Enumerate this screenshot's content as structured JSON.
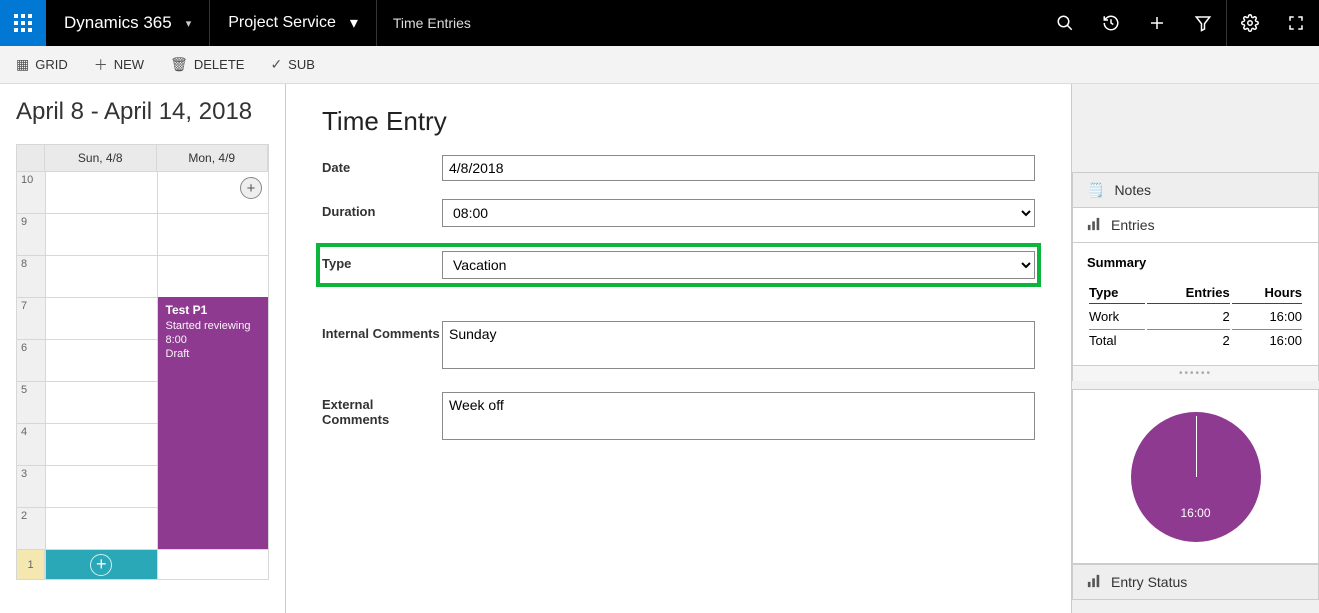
{
  "topbar": {
    "brand": "Dynamics 365",
    "module": "Project Service",
    "breadcrumb": "Time Entries"
  },
  "cmdbar": {
    "grid": "GRID",
    "new": "NEW",
    "delete": "DELETE",
    "submit": "SUBMIT"
  },
  "calendar": {
    "title": "April 8 - April 14, 2018",
    "cols": [
      "Sun, 4/8",
      "Mon, 4/9"
    ],
    "hours": [
      "10",
      "9",
      "8",
      "7",
      "6",
      "5",
      "4",
      "3",
      "2"
    ],
    "allday_label": "1",
    "event": {
      "title": "Test P1",
      "line2": "Started reviewing",
      "line3": "8:00",
      "line4": "Draft"
    }
  },
  "form": {
    "title": "Time Entry",
    "labels": {
      "date": "Date",
      "duration": "Duration",
      "type": "Type",
      "internal": "Internal Comments",
      "external": "External Comments"
    },
    "values": {
      "date": "4/8/2018",
      "duration": "08:00",
      "type": "Vacation",
      "internal": "Sunday",
      "external": "Week off"
    }
  },
  "rail": {
    "tabs": {
      "notes": "Notes",
      "entries": "Entries",
      "entry_status": "Entry Status"
    },
    "summary": {
      "title": "Summary",
      "headers": {
        "type": "Type",
        "entries": "Entries",
        "hours": "Hours"
      },
      "rows": [
        {
          "type": "Work",
          "entries": "2",
          "hours": "16:00"
        }
      ],
      "total": {
        "label": "Total",
        "entries": "2",
        "hours": "16:00"
      }
    },
    "pie_label": "16:00"
  },
  "chart_data": {
    "type": "pie",
    "title": "",
    "series": [
      {
        "name": "Work",
        "value": 16.0
      }
    ],
    "total_label": "16:00"
  }
}
